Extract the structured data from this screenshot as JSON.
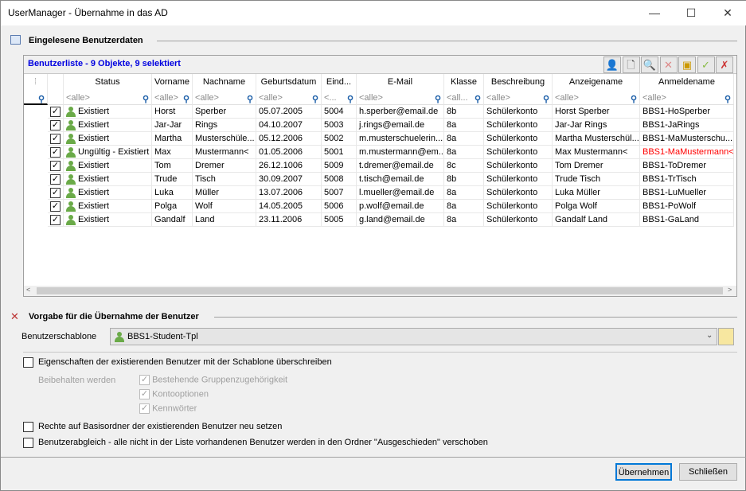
{
  "window": {
    "title": "UserManager - Übernahme in das AD",
    "minimize": "—",
    "maximize": "☐",
    "close": "✕"
  },
  "section1": {
    "title": "Eingelesene Benutzerdaten"
  },
  "grid": {
    "title": "Benutzerliste - 9 Objekte, 9 selektiert",
    "toolbar": [
      "user-edit",
      "new-document",
      "search-check",
      "delete",
      "export",
      "check",
      "uncheck"
    ],
    "columns": [
      "Status",
      "Vorname",
      "Nachname",
      "Geburtsdatum",
      "Eind...",
      "E-Mail",
      "Klasse",
      "Beschreibung",
      "Anzeigename",
      "Anmeldename"
    ],
    "filters": [
      "<alle>",
      "<alle>",
      "<alle>",
      "<alle>",
      "<...",
      "<alle>",
      "<all...",
      "<alle>",
      "<alle>",
      "<alle>"
    ],
    "error_color": "#ff0000",
    "rows": [
      {
        "checked": true,
        "cells": [
          "Existiert",
          "Horst",
          "Sperber",
          "05.07.2005",
          "5004",
          "h.sperber@email.de",
          "8b",
          "Schülerkonto",
          "Horst Sperber",
          "BBS1-HoSperber"
        ]
      },
      {
        "checked": true,
        "cells": [
          "Existiert",
          "Jar-Jar",
          "Rings",
          "04.10.2007",
          "5003",
          "j.rings@email.de",
          "8a",
          "Schülerkonto",
          "Jar-Jar Rings",
          "BBS1-JaRings"
        ]
      },
      {
        "checked": true,
        "cells": [
          "Existiert",
          "Martha",
          "Musterschüle...",
          "05.12.2006",
          "5002",
          "m.musterschuelerin...",
          "8a",
          "Schülerkonto",
          "Martha Musterschül...",
          "BBS1-MaMusterschu..."
        ]
      },
      {
        "checked": true,
        "error": true,
        "cells": [
          "Ungültig - Existiert",
          "Max",
          "Mustermann<",
          "01.05.2006",
          "5001",
          "m.mustermann@em...",
          "8a",
          "Schülerkonto",
          "Max Mustermann<",
          "BBS1-MaMustermann<"
        ]
      },
      {
        "checked": true,
        "cells": [
          "Existiert",
          "Tom",
          "Dremer",
          "26.12.1006",
          "5009",
          "t.dremer@email.de",
          "8c",
          "Schülerkonto",
          "Tom Dremer",
          "BBS1-ToDremer"
        ]
      },
      {
        "checked": true,
        "cells": [
          "Existiert",
          "Trude",
          "Tisch",
          "30.09.2007",
          "5008",
          "t.tisch@email.de",
          "8b",
          "Schülerkonto",
          "Trude Tisch",
          "BBS1-TrTisch"
        ]
      },
      {
        "checked": true,
        "cells": [
          "Existiert",
          "Luka",
          "Müller",
          "13.07.2006",
          "5007",
          "l.mueller@email.de",
          "8a",
          "Schülerkonto",
          "Luka Müller",
          "BBS1-LuMueller"
        ]
      },
      {
        "checked": true,
        "cells": [
          "Existiert",
          "Polga",
          "Wolf",
          "14.05.2005",
          "5006",
          "p.wolf@email.de",
          "8a",
          "Schülerkonto",
          "Polga Wolf",
          "BBS1-PoWolf"
        ]
      },
      {
        "checked": true,
        "cells": [
          "Existiert",
          "Gandalf",
          "Land",
          "23.11.2006",
          "5005",
          "g.land@email.de",
          "8a",
          "Schülerkonto",
          "Gandalf Land",
          "BBS1-GaLand"
        ]
      }
    ]
  },
  "section2": {
    "title": "Vorgabe für die Übernahme der Benutzer",
    "template_label": "Benutzerschablone",
    "template_value": "BBS1-Student-Tpl",
    "overwrite": {
      "label": "Eigenschaften der existierenden Benutzer mit der Schablone überschreiben",
      "checked": false
    },
    "keep_label": "Beibehalten werden",
    "keep": [
      {
        "label": "Bestehende Gruppenzugehörigkeit",
        "checked": true
      },
      {
        "label": "Kontooptionen",
        "checked": true
      },
      {
        "label": "Kennwörter",
        "checked": true
      }
    ],
    "rights": {
      "label": "Rechte auf Basisordner der existierenden Benutzer neu setzen",
      "checked": false
    },
    "sync": {
      "label": "Benutzerabgleich - alle nicht in der Liste vorhandenen Benutzer werden in den Ordner \"Ausgeschieden\" verschoben",
      "checked": false
    }
  },
  "buttons": {
    "apply": "Übernehmen",
    "close": "Schließen"
  }
}
